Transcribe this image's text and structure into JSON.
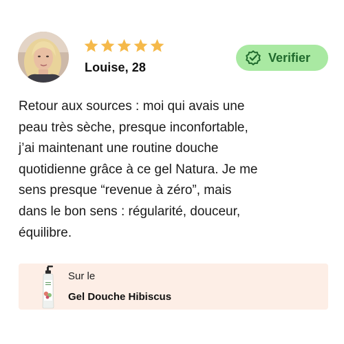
{
  "review": {
    "rating": 5,
    "rating_max": 5,
    "star_color": "#f5b94a",
    "reviewer_name": "Louise, 28",
    "verified_label": "Verifier",
    "verified_icon": "check-badge-icon",
    "text_lines": [
      "Retour aux sources : moi qui avais une",
      "peau très sèche, presque inconfortable,",
      "j’ai maintenant une routine douche",
      "quotidienne grâce à ce gel Natura. Je me",
      "sens presque “revenue à zéro”, mais",
      "dans le bon sens : régularité, douceur,",
      "équilibre."
    ]
  },
  "product": {
    "prefix": "Sur le",
    "name": "Gel Douche Hibiscus",
    "thumbnail_icon": "pump-bottle-icon"
  },
  "colors": {
    "badge_bg": "#a9e9a2",
    "badge_text": "#1f6a2c",
    "product_card_bg": "#fdeee6"
  }
}
